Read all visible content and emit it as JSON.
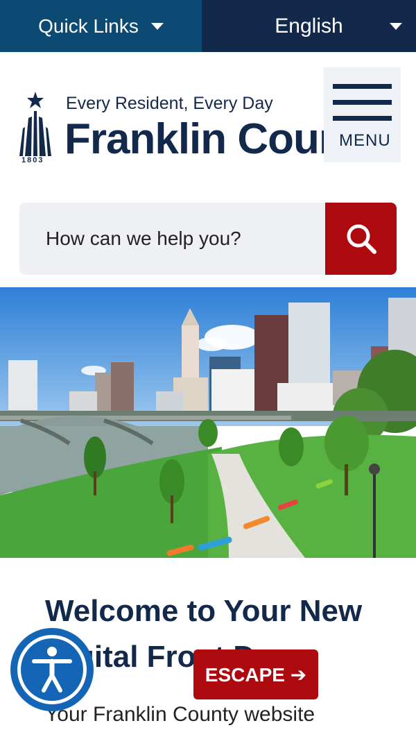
{
  "topbar": {
    "quick_links": "Quick Links",
    "language": "English"
  },
  "header": {
    "tagline": "Every Resident, Every Day",
    "county_name": "Franklin County",
    "year": "1803",
    "menu_label": "MENU"
  },
  "search": {
    "placeholder": "How can we help you?"
  },
  "welcome": {
    "heading": "Welcome to Your New Digital Front Door",
    "subtext": "Your Franklin County website"
  },
  "escape": {
    "label": "ESCAPE ➔"
  },
  "colors": {
    "navy": "#13294b",
    "blue": "#0d4a73",
    "red": "#ad0a0f",
    "a11y_blue": "#1565b7"
  }
}
